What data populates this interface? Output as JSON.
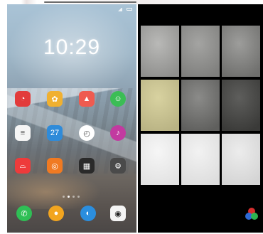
{
  "status_bar": {
    "text": ""
  },
  "lockscreen": {
    "time": "10:29",
    "date": ""
  },
  "home": {
    "apps": [
      {
        "id": "app-red-circle",
        "label": "",
        "color": "#e23b3b",
        "glyph": "◔",
        "icon": "gauge-icon"
      },
      {
        "id": "app-petal",
        "label": "",
        "color": "#f0b030",
        "glyph": "✿",
        "icon": "flower-icon"
      },
      {
        "id": "app-gallery",
        "label": "",
        "color": "#ef5b50",
        "glyph": "▲",
        "icon": "gallery-icon"
      },
      {
        "id": "app-chat",
        "label": "",
        "color": "#3bbd55",
        "glyph": "☺",
        "icon": "chat-icon"
      },
      {
        "id": "app-notes",
        "label": "",
        "color": "#f5f5f5",
        "glyph": "≡",
        "icon": "notes-icon"
      },
      {
        "id": "app-calendar",
        "label": "",
        "color": "#2f8bd9",
        "glyph": "27",
        "icon": "calendar-icon"
      },
      {
        "id": "app-clock",
        "label": "",
        "color": "#ffffff",
        "glyph": "◴",
        "icon": "clock-icon"
      },
      {
        "id": "app-music",
        "label": "",
        "color": "#c23aa0",
        "glyph": "♪",
        "icon": "music-icon"
      },
      {
        "id": "app-store",
        "label": "",
        "color": "#ee3b3b",
        "glyph": "⌓",
        "icon": "shopping-bag-icon"
      },
      {
        "id": "app-game",
        "label": "",
        "color": "#f07a22",
        "glyph": "◎",
        "icon": "gamepad-icon"
      },
      {
        "id": "app-folder",
        "label": "",
        "color": "#2a2a2a",
        "glyph": "▦",
        "icon": "folder-icon"
      },
      {
        "id": "app-settings",
        "label": "",
        "color": "#4a4a4a",
        "glyph": "⚙",
        "icon": "gear-icon"
      }
    ],
    "dock": [
      {
        "id": "dock-phone",
        "label": "",
        "color": "#2fbf55",
        "glyph": "✆",
        "icon": "phone-icon"
      },
      {
        "id": "dock-contacts",
        "label": "",
        "color": "#f2a51f",
        "glyph": "●",
        "icon": "contacts-icon"
      },
      {
        "id": "dock-browser",
        "label": "",
        "color": "#2b8ede",
        "glyph": "◐",
        "icon": "browser-icon"
      },
      {
        "id": "dock-camera",
        "label": "",
        "color": "#f4f4f4",
        "glyph": "◉",
        "icon": "camera-icon"
      }
    ],
    "page_count": 4,
    "active_page": 1
  },
  "filters": {
    "tiles": [
      {
        "caption": "",
        "tone": "#b9b9b7",
        "tone2": "#8f8f8d"
      },
      {
        "caption": "",
        "tone": "#a4a4a2",
        "tone2": "#7f7f7d"
      },
      {
        "caption": "",
        "tone": "#9d9d9b",
        "tone2": "#6f6f6d"
      },
      {
        "caption": "",
        "tone": "#d8d2a0",
        "tone2": "#b9b384"
      },
      {
        "caption": "",
        "tone": "#8b8b89",
        "tone2": "#5f5f5d"
      },
      {
        "caption": "",
        "tone": "#5e5e5c",
        "tone2": "#3a3a38"
      },
      {
        "caption": "",
        "tone": "#f6f6f6",
        "tone2": "#e2e2e2"
      },
      {
        "caption": "",
        "tone": "#f2f2f2",
        "tone2": "#dddddd"
      },
      {
        "caption": "",
        "tone": "#ececec",
        "tone2": "#d4d4d4"
      }
    ],
    "color_icon": "rgb-circles-icon"
  }
}
